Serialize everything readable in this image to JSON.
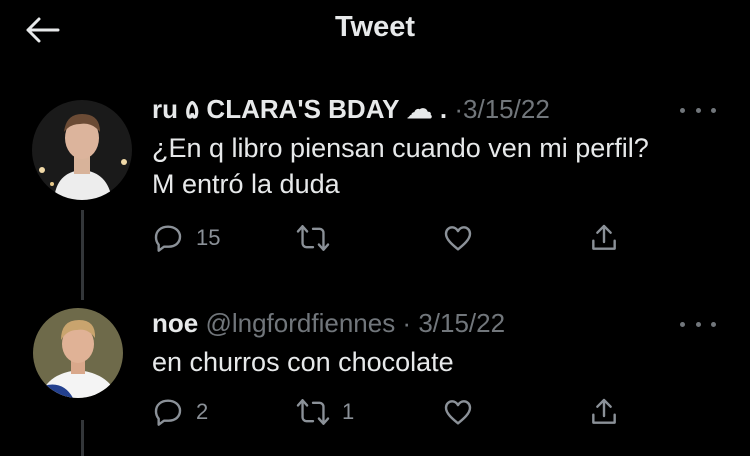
{
  "header": {
    "title": "Tweet"
  },
  "tweets": [
    {
      "name": "ru ۵ CLARA'S BDAY",
      "name_suffix": "☁ .",
      "handle": "",
      "date": "3/15/22",
      "text_lines": [
        "¿En q libro piensan cuando ven mi perfil?",
        "M entró la duda"
      ],
      "replies": "15",
      "retweets": "",
      "likes": ""
    },
    {
      "name": "noe",
      "name_suffix": "",
      "handle": "@lngfordfiennes",
      "date": "3/15/22",
      "text_lines": [
        "en churros con chocolate"
      ],
      "replies": "2",
      "retweets": "1",
      "likes": ""
    }
  ],
  "colors": {
    "background": "#000000",
    "text": "#e7e9ea",
    "secondary": "#71767b",
    "thread_line": "#333639"
  },
  "icons": [
    "back-arrow-icon",
    "more-icon",
    "reply-icon",
    "retweet-icon",
    "like-icon",
    "share-icon"
  ]
}
